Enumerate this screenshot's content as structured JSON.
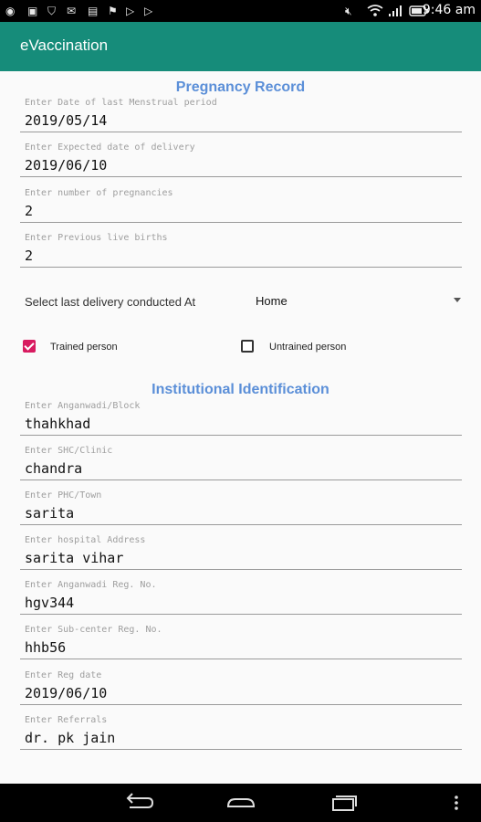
{
  "status_bar": {
    "time": "9:46 am"
  },
  "app": {
    "title": "eVaccination"
  },
  "pregnancy_record": {
    "title": "Pregnancy Record",
    "fields": [
      {
        "label": "Enter Date of last Menstrual period",
        "value": "2019/05/14"
      },
      {
        "label": "Enter Expected date of delivery",
        "value": "2019/06/10"
      },
      {
        "label": "Enter number of pregnancies",
        "value": "2"
      },
      {
        "label": "Enter Previous live births",
        "value": "2"
      }
    ],
    "delivery": {
      "label": "Select last delivery conducted At",
      "selected": "Home"
    },
    "trained_person": {
      "label": "Trained person",
      "checked": true
    },
    "untrained_person": {
      "label": "Untrained person",
      "checked": false
    }
  },
  "institutional_identification": {
    "title": "Institutional Identification",
    "fields": [
      {
        "label": "Enter Anganwadi/Block",
        "value": "thahkhad"
      },
      {
        "label": "Enter SHC/Clinic",
        "value": "chandra"
      },
      {
        "label": "Enter PHC/Town",
        "value": "sarita"
      },
      {
        "label": "Enter hospital Address",
        "value": "sarita vihar"
      },
      {
        "label": "Enter Anganwadi Reg. No.",
        "value": "hgv344"
      },
      {
        "label": "Enter Sub-center Reg. No.",
        "value": "hhb56"
      },
      {
        "label": "Enter Reg date",
        "value": "2019/06/10"
      },
      {
        "label": "Enter Referrals",
        "value": "dr. pk jain"
      }
    ]
  },
  "colors": {
    "app_bar": "#168c7a",
    "section_title": "#5b8fd8",
    "checkbox_checked": "#d81b60"
  },
  "icons": [
    "eye-icon",
    "image-icon",
    "shield-icon",
    "mail-icon",
    "briefcase-icon",
    "flag-icon",
    "play-store-icon",
    "mute-icon",
    "wifi-icon",
    "signal-icon",
    "battery-icon",
    "back-icon",
    "home-icon",
    "recents-icon",
    "menu-icon"
  ]
}
